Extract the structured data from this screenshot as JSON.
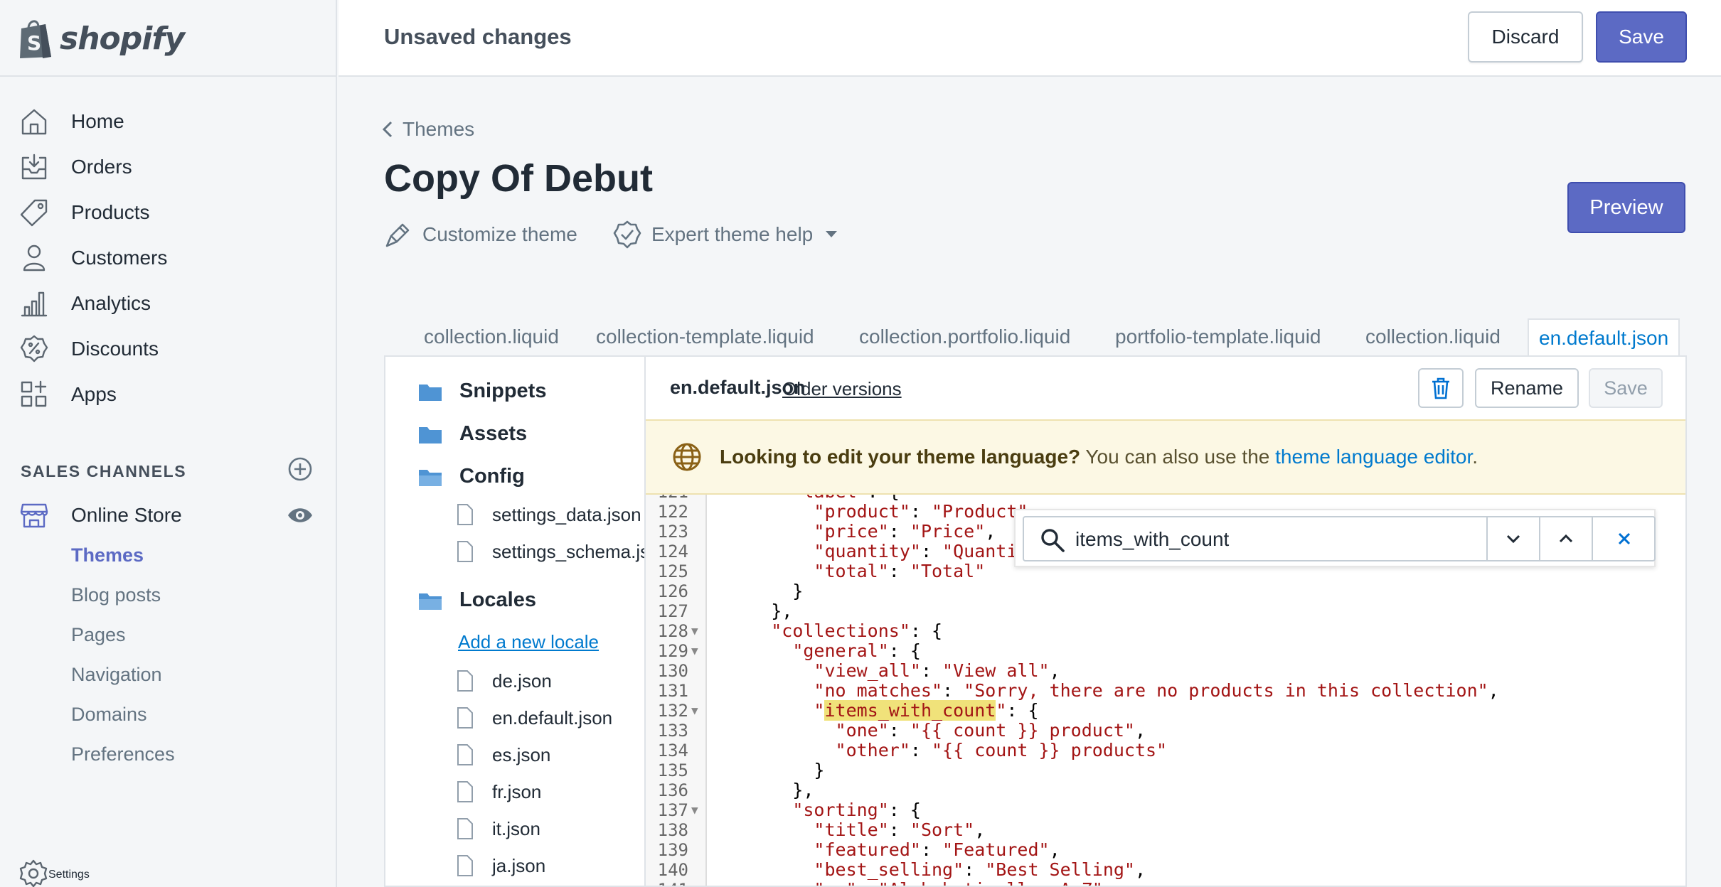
{
  "brand": {
    "name": "shopify"
  },
  "topbar": {
    "status": "Unsaved changes",
    "discard_label": "Discard",
    "save_label": "Save"
  },
  "sidebar": {
    "items": [
      {
        "label": "Home",
        "icon": "home-icon"
      },
      {
        "label": "Orders",
        "icon": "orders-icon"
      },
      {
        "label": "Products",
        "icon": "tag-icon"
      },
      {
        "label": "Customers",
        "icon": "person-icon"
      },
      {
        "label": "Analytics",
        "icon": "bar-chart-icon"
      },
      {
        "label": "Discounts",
        "icon": "discount-icon"
      },
      {
        "label": "Apps",
        "icon": "apps-icon"
      }
    ],
    "sales_channels_title": "SALES CHANNELS",
    "online_store": "Online Store",
    "sub_items": [
      "Themes",
      "Blog posts",
      "Pages",
      "Navigation",
      "Domains",
      "Preferences"
    ],
    "settings": "Settings"
  },
  "page": {
    "back": "Themes",
    "title": "Copy Of Debut",
    "customize": "Customize theme",
    "expert_help": "Expert theme help",
    "preview": "Preview"
  },
  "tabs": [
    "collection.liquid",
    "collection-template.liquid",
    "collection.portfolio.liquid",
    "portfolio-template.liquid",
    "collection.liquid",
    "en.default.json"
  ],
  "tree": {
    "folders": [
      "Snippets",
      "Assets",
      "Config",
      "Locales"
    ],
    "config_files": [
      "settings_data.json",
      "settings_schema.json"
    ],
    "add_locale": "Add a new locale",
    "locale_files": [
      "de.json",
      "en.default.json",
      "es.json",
      "fr.json",
      "it.json",
      "ja.json"
    ]
  },
  "editor": {
    "file_name": "en.default.json",
    "older_versions": "Older versions",
    "rename": "Rename",
    "save": "Save",
    "banner_bold": "Looking to edit your theme language?",
    "banner_text": " You can also use the ",
    "banner_link": "theme language editor",
    "banner_end": ".",
    "search_value": "items_with_count"
  },
  "code_lines": [
    {
      "n": "121",
      "fold": false,
      "text": "      \"label\": {"
    },
    {
      "n": "122",
      "fold": false,
      "text": "        \"product\": \"Product\","
    },
    {
      "n": "123",
      "fold": false,
      "text": "        \"price\": \"Price\","
    },
    {
      "n": "124",
      "fold": false,
      "text": "        \"quantity\": \"Quantity\","
    },
    {
      "n": "125",
      "fold": false,
      "text": "        \"total\": \"Total\""
    },
    {
      "n": "126",
      "fold": false,
      "text": "      }"
    },
    {
      "n": "127",
      "fold": false,
      "text": "    },"
    },
    {
      "n": "128",
      "fold": true,
      "text": "    \"collections\": {"
    },
    {
      "n": "129",
      "fold": true,
      "text": "      \"general\": {"
    },
    {
      "n": "130",
      "fold": false,
      "text": "        \"view_all\": \"View all\","
    },
    {
      "n": "131",
      "fold": false,
      "text": "        \"no_matches\": \"Sorry, there are no products in this collection\","
    },
    {
      "n": "132",
      "fold": true,
      "text": "        \"items_with_count\": {"
    },
    {
      "n": "133",
      "fold": false,
      "text": "          \"one\": \"{{ count }} product\","
    },
    {
      "n": "134",
      "fold": false,
      "text": "          \"other\": \"{{ count }} products\""
    },
    {
      "n": "135",
      "fold": false,
      "text": "        }"
    },
    {
      "n": "136",
      "fold": false,
      "text": "      },"
    },
    {
      "n": "137",
      "fold": true,
      "text": "      \"sorting\": {"
    },
    {
      "n": "138",
      "fold": false,
      "text": "        \"title\": \"Sort\","
    },
    {
      "n": "139",
      "fold": false,
      "text": "        \"featured\": \"Featured\","
    },
    {
      "n": "140",
      "fold": false,
      "text": "        \"best_selling\": \"Best Selling\","
    },
    {
      "n": "141",
      "fold": false,
      "text": "        \"az\": \"Alphabetically, A-Z\","
    }
  ],
  "colors": {
    "accent": "#5c6ac4",
    "link": "#007ace",
    "string": "#a31515",
    "banner": "#fcf8e4"
  }
}
